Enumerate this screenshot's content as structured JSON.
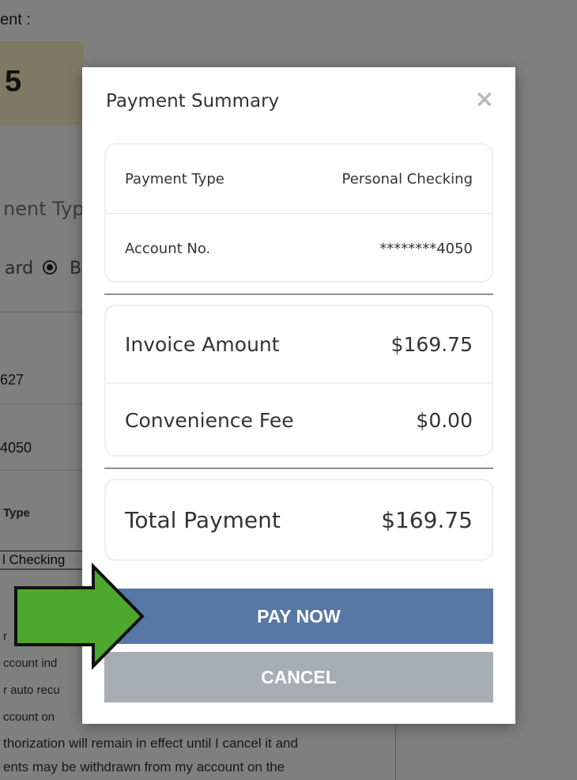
{
  "background": {
    "amount_partial_label": "ent :",
    "amount_partial_value": "5",
    "payment_type_heading": "nent Typ",
    "radio_card_fragment": "ard",
    "radio_bank_fragment": "B",
    "field_value_1": "627",
    "field_value_2": "4050",
    "type_label": "Type",
    "select_value": "l Checking",
    "text_lines": [
      "r",
      "ccount ind",
      "r auto recu",
      "ccount on",
      "thorization will remain in effect until I cancel it and",
      "ents may be withdrawn from my account on the"
    ]
  },
  "modal": {
    "title": "Payment Summary",
    "close_glyph": "×",
    "details": [
      {
        "label": "Payment Type",
        "value": "Personal Checking"
      },
      {
        "label": "Account No.",
        "value": "********4050"
      }
    ],
    "amounts": [
      {
        "label": "Invoice Amount",
        "value": "$169.75"
      },
      {
        "label": "Convenience Fee",
        "value": "$0.00"
      }
    ],
    "total": {
      "label": "Total Payment",
      "value": "$169.75"
    },
    "pay_button": "PAY NOW",
    "cancel_button": "CANCEL"
  },
  "colors": {
    "pay_button": "#5777a5",
    "cancel_button": "#a8acb3",
    "arrow_fill": "#4ea72e",
    "overlay": "rgba(0,0,0,0.5)"
  },
  "icons": {
    "close": "close-icon",
    "arrow": "green-pointer-arrow-icon"
  }
}
